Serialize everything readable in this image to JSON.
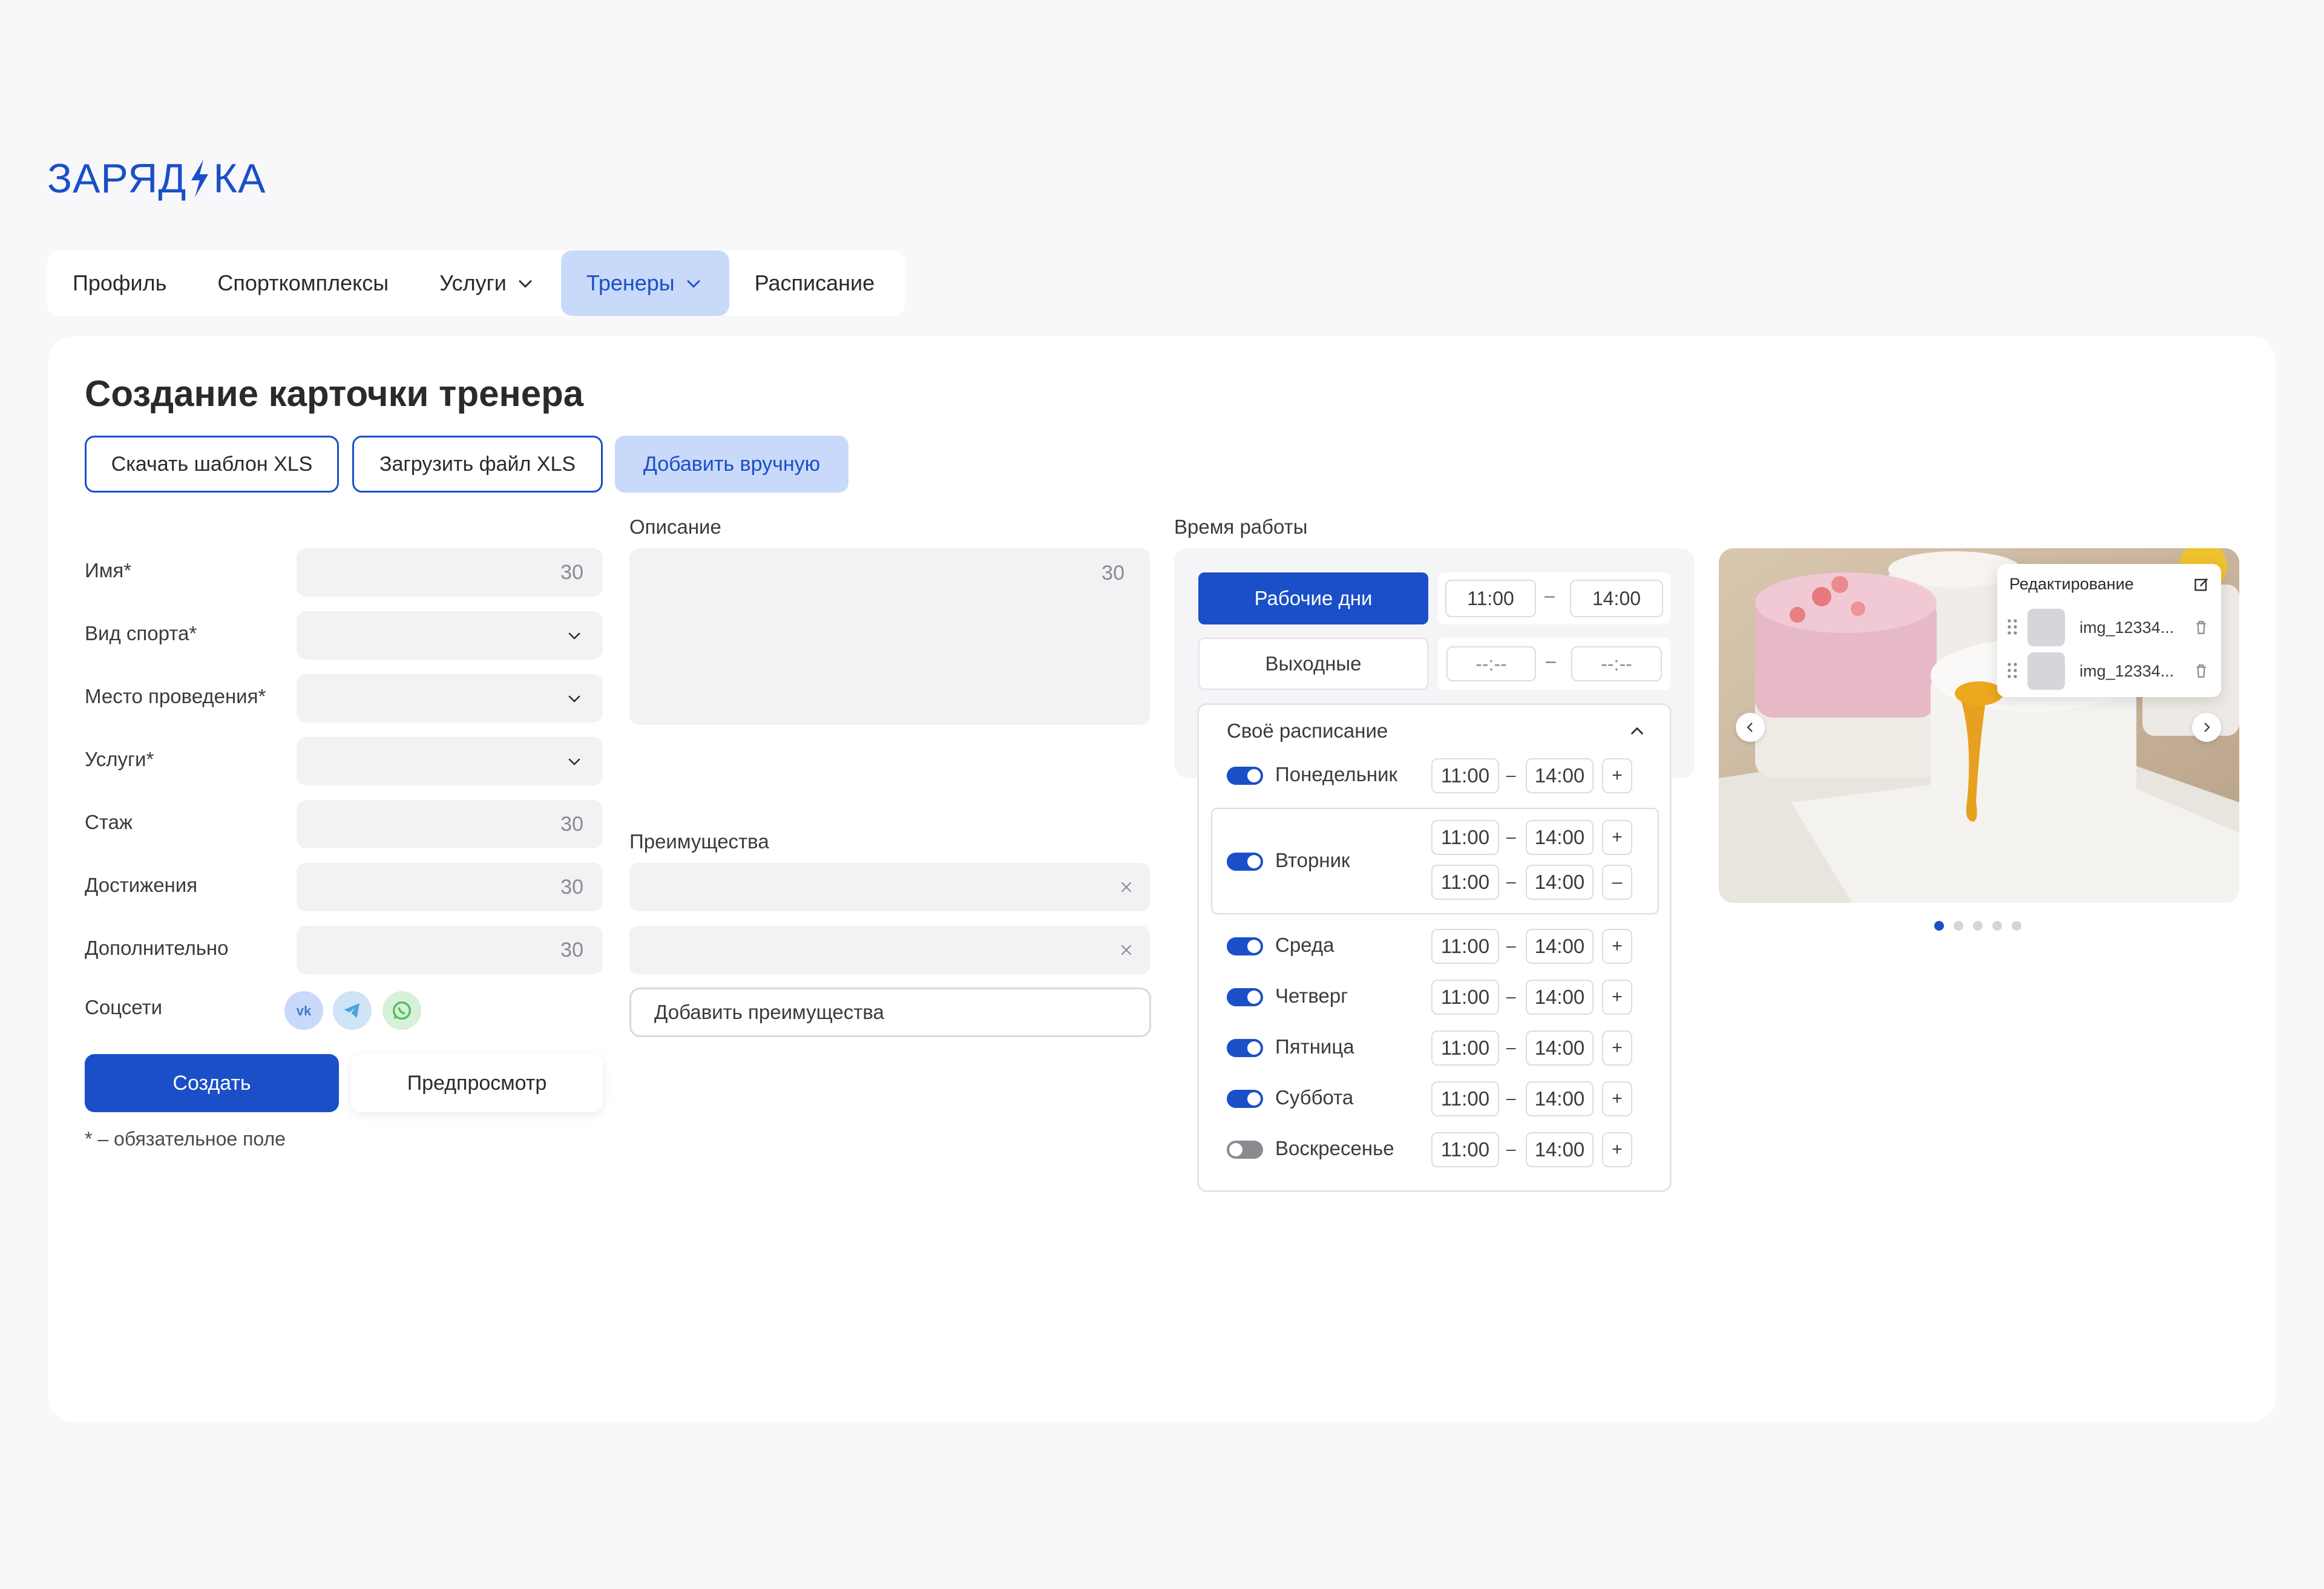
{
  "brand": {
    "logo_left": "ЗАРЯД",
    "logo_right": "КА",
    "accent": "#1a4fc7"
  },
  "nav": {
    "items": [
      {
        "label": "Профиль"
      },
      {
        "label": "Спорткомплексы"
      },
      {
        "label": "Услуги"
      },
      {
        "label": "Тренеры"
      },
      {
        "label": "Расписание"
      }
    ],
    "active": "Тренеры"
  },
  "page": {
    "title": "Создание карточки тренера",
    "actions": {
      "download_xls": "Скачать шаблон XLS",
      "upload_xls": "Загрузить файл XLS",
      "add_manual": "Добавить вручную"
    }
  },
  "form": {
    "name": {
      "label": "Имя*",
      "counter": "30"
    },
    "sport": {
      "label": "Вид спорта*"
    },
    "place": {
      "label": "Место проведения*"
    },
    "services": {
      "label": "Услуги*"
    },
    "experience": {
      "label": "Стаж",
      "counter": "30"
    },
    "achievements": {
      "label": "Достижения",
      "counter": "30"
    },
    "extra": {
      "label": "Дополнительно",
      "counter": "30"
    },
    "socials": {
      "label": "Соцсети",
      "icons": [
        "vk-icon",
        "telegram-icon",
        "whatsapp-icon"
      ]
    },
    "create": "Создать",
    "preview": "Предпросмотр",
    "required_note": "* – обязательное поле"
  },
  "description": {
    "label": "Описание",
    "counter": "30"
  },
  "advantages": {
    "label": "Преимущества",
    "add": "Добавить преимущества"
  },
  "schedule": {
    "label": "Время работы",
    "workdays": {
      "label": "Рабочие дни",
      "from": "11:00",
      "to": "14:00"
    },
    "weekends": {
      "label": "Выходные",
      "from": "--:--",
      "to": "--:--"
    },
    "dash": "–",
    "own_title": "Своё расписание",
    "days": [
      {
        "name": "Понедельник",
        "on": true,
        "from": "11:00",
        "to": "14:00"
      },
      {
        "name": "Вторник",
        "on": true,
        "from": "11:00",
        "to": "14:00",
        "from2": "11:00",
        "to2": "14:00"
      },
      {
        "name": "Среда",
        "on": true,
        "from": "11:00",
        "to": "14:00"
      },
      {
        "name": "Четверг",
        "on": true,
        "from": "11:00",
        "to": "14:00"
      },
      {
        "name": "Пятница",
        "on": true,
        "from": "11:00",
        "to": "14:00"
      },
      {
        "name": "Суббота",
        "on": true,
        "from": "11:00",
        "to": "14:00"
      },
      {
        "name": "Воскресенье",
        "on": false,
        "from": "11:00",
        "to": "14:00"
      }
    ],
    "plus": "+",
    "minus": "–"
  },
  "gallery": {
    "edit_title": "Редактирование",
    "files": [
      "img_12334...",
      "img_12334..."
    ],
    "dots": 5,
    "active_dot": 1
  }
}
